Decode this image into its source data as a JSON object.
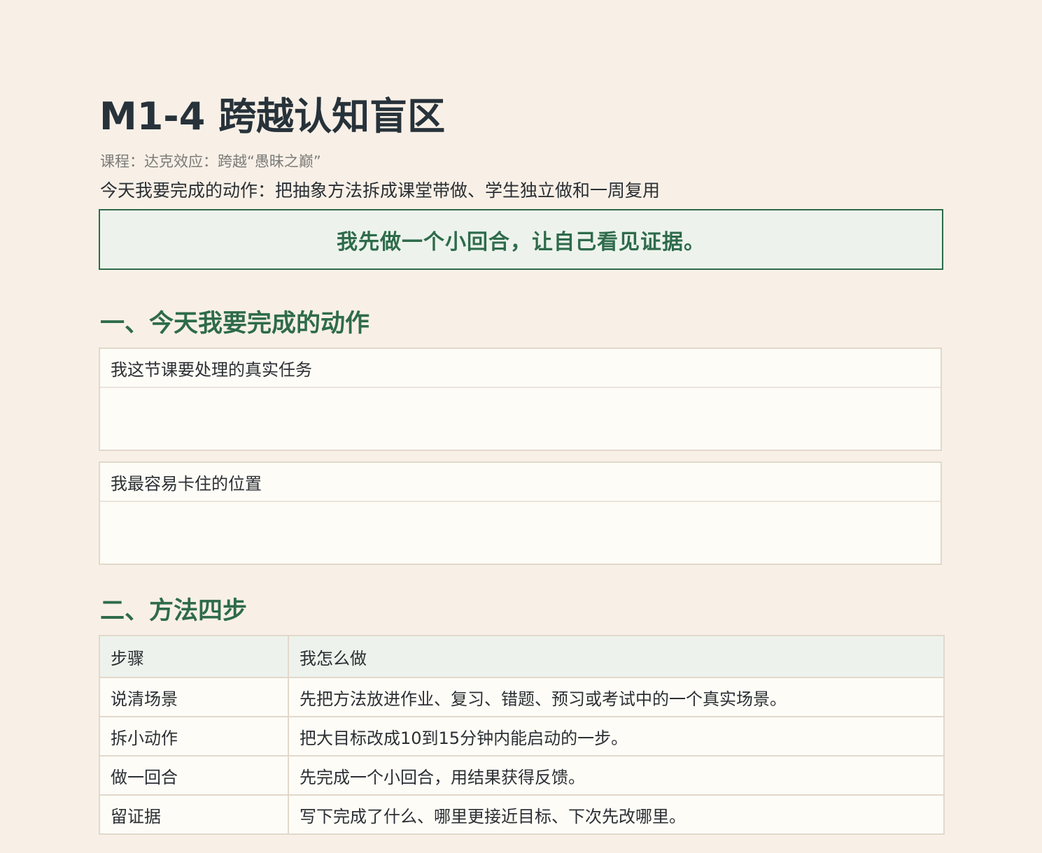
{
  "header": {
    "title": "M1-4 跨越认知盲区",
    "course": "课程：达克效应：跨越“愚昧之巅”",
    "goal": "今天我要完成的动作：把抽象方法拆成课堂带做、学生独立做和一周复用"
  },
  "callout": {
    "text": "我先做一个小回合，让自己看见证据。"
  },
  "section1": {
    "heading": "一、今天我要完成的动作",
    "boxes": [
      {
        "label": "我这节课要处理的真实任务"
      },
      {
        "label": "我最容易卡住的位置"
      }
    ]
  },
  "section2": {
    "heading": "二、方法四步",
    "columns": [
      "步骤",
      "我怎么做"
    ],
    "rows": [
      {
        "step": "说清场景",
        "how": "先把方法放进作业、复习、错题、预习或考试中的一个真实场景。"
      },
      {
        "step": "拆小动作",
        "how": "把大目标改成10到15分钟内能启动的一步。"
      },
      {
        "step": "做一回合",
        "how": "先完成一个小回合，用结果获得反馈。"
      },
      {
        "step": "留证据",
        "how": "写下完成了什么、哪里更接近目标、下次先改哪里。"
      }
    ]
  },
  "colors": {
    "accent": "#2e6b4b",
    "background": "#f8f0e7",
    "panel": "#fefcf7",
    "callout_bg": "#edf3ec"
  }
}
